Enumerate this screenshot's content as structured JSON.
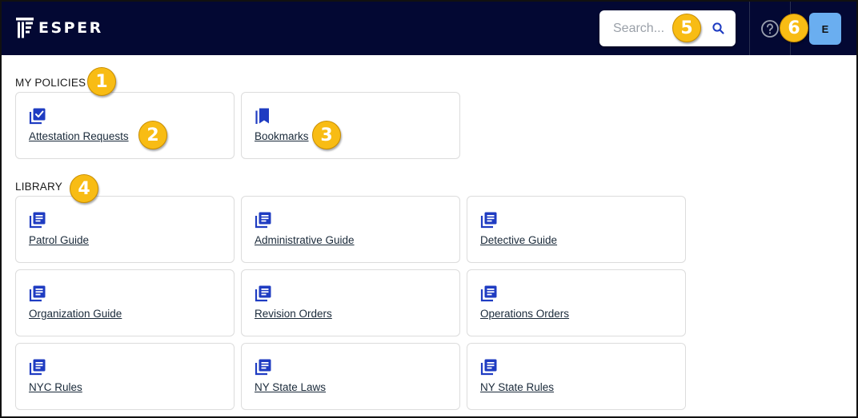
{
  "header": {
    "brand": "ESPER",
    "search_placeholder": "Search...",
    "avatar_initial": "E",
    "background_color": "#030833",
    "avatar_color": "#6aaef0"
  },
  "my_policies": {
    "title": "MY POLICIES",
    "items": [
      {
        "label": "Attestation Requests",
        "icon": "checklist-icon"
      },
      {
        "label": "Bookmarks",
        "icon": "bookmark-icon"
      }
    ]
  },
  "library": {
    "title": "LIBRARY",
    "items": [
      {
        "label": "Patrol Guide",
        "icon": "library-books-icon"
      },
      {
        "label": "Administrative Guide",
        "icon": "library-books-icon"
      },
      {
        "label": "Detective Guide",
        "icon": "library-books-icon"
      },
      {
        "label": "Organization Guide",
        "icon": "library-books-icon"
      },
      {
        "label": "Revision Orders",
        "icon": "library-books-icon"
      },
      {
        "label": "Operations Orders",
        "icon": "library-books-icon"
      },
      {
        "label": "NYC Rules",
        "icon": "library-books-icon"
      },
      {
        "label": "NY State Laws",
        "icon": "library-books-icon"
      },
      {
        "label": "NY State Rules",
        "icon": "library-books-icon"
      }
    ]
  },
  "badges": [
    "1",
    "2",
    "3",
    "4",
    "5",
    "6"
  ],
  "colors": {
    "icon_blue": "#1f3cc2",
    "badge_yellow": "#f8bc14"
  }
}
